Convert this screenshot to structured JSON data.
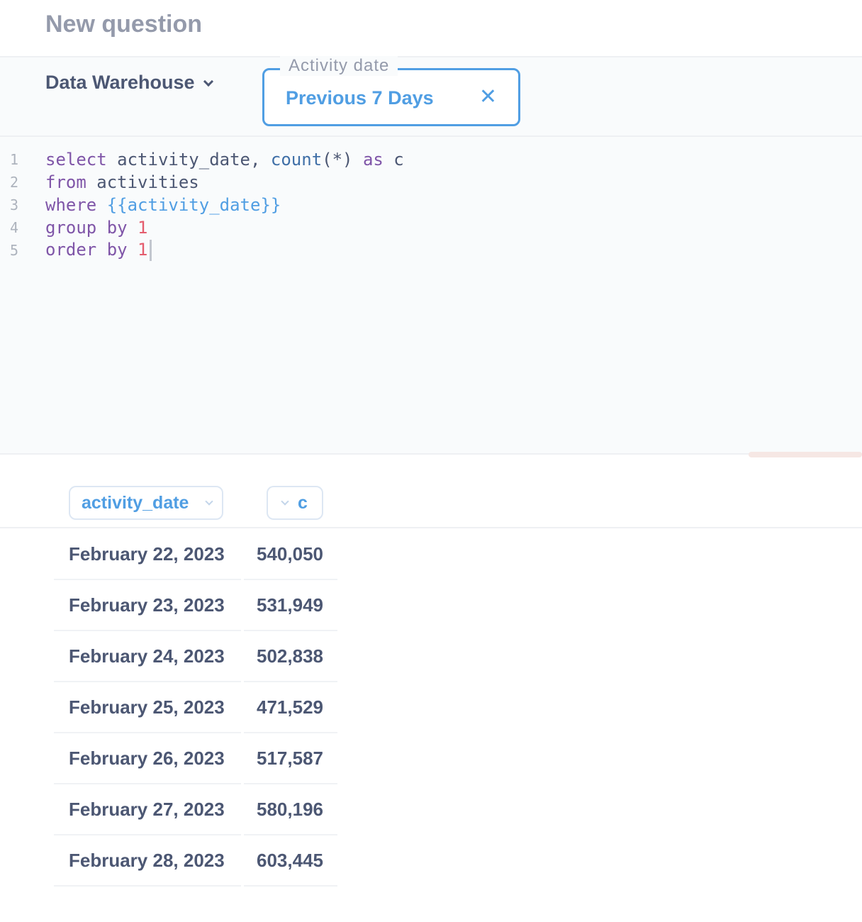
{
  "header": {
    "title": "New question"
  },
  "params": {
    "database": "Data Warehouse",
    "filter": {
      "label": "Activity date",
      "value": "Previous 7 Days"
    }
  },
  "editor": {
    "lines": [
      {
        "num": "1",
        "tokens": [
          [
            "kw",
            "select"
          ],
          [
            "t",
            " activity_date, "
          ],
          [
            "fn",
            "count"
          ],
          [
            "t",
            "(*) "
          ],
          [
            "kw",
            "as"
          ],
          [
            "t",
            " c"
          ]
        ]
      },
      {
        "num": "2",
        "tokens": [
          [
            "kw",
            "from"
          ],
          [
            "t",
            " activities"
          ]
        ]
      },
      {
        "num": "3",
        "tokens": [
          [
            "kw",
            "where"
          ],
          [
            "t",
            " "
          ],
          [
            "var",
            "{{activity_date}}"
          ]
        ]
      },
      {
        "num": "4",
        "tokens": [
          [
            "kw",
            "group by"
          ],
          [
            "t",
            " "
          ],
          [
            "num",
            "1"
          ]
        ]
      },
      {
        "num": "5",
        "tokens": [
          [
            "kw",
            "order by"
          ],
          [
            "t",
            " "
          ],
          [
            "num",
            "1"
          ]
        ]
      }
    ]
  },
  "results": {
    "columns": [
      "activity_date",
      "c"
    ],
    "rows": [
      [
        "February 22, 2023",
        "540,050"
      ],
      [
        "February 23, 2023",
        "531,949"
      ],
      [
        "February 24, 2023",
        "502,838"
      ],
      [
        "February 25, 2023",
        "471,529"
      ],
      [
        "February 26, 2023",
        "517,587"
      ],
      [
        "February 27, 2023",
        "580,196"
      ],
      [
        "February 28, 2023",
        "603,445"
      ]
    ]
  }
}
